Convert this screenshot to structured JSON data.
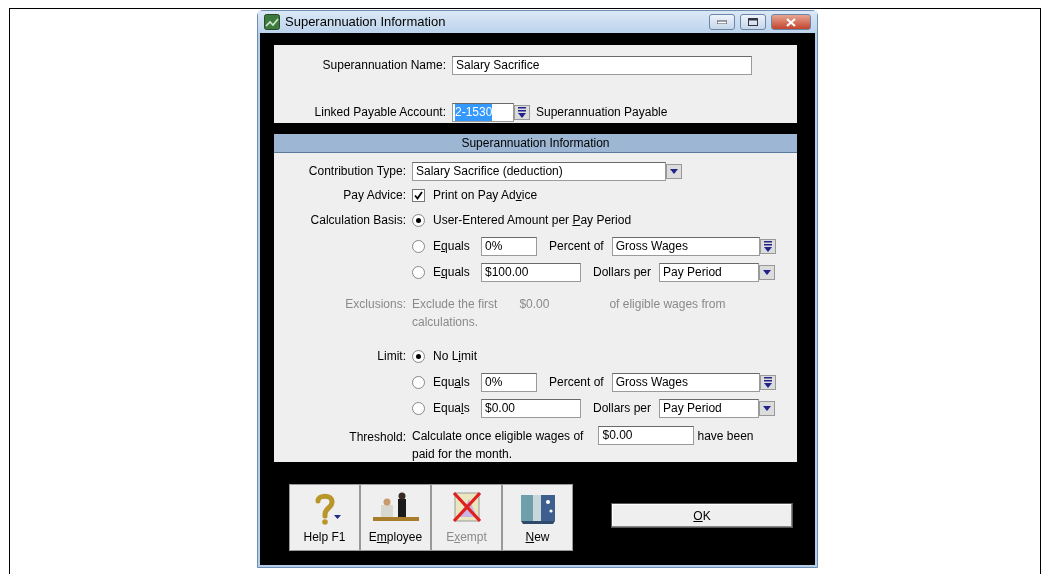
{
  "window": {
    "title": "Superannuation Information"
  },
  "name_field": {
    "label": "Superannuation Name:",
    "value": "Salary Sacrifice"
  },
  "linked_account": {
    "label": "Linked Payable Account:",
    "value": "2-1530",
    "selected": true,
    "account_name": "Superannuation Payable"
  },
  "section_header": "Superannuation Information",
  "contribution_type": {
    "label": "Contribution Type:",
    "value": "Salary Sacrifice (deduction)"
  },
  "pay_advice": {
    "label": "Pay Advice:",
    "checked": true,
    "option_parts": [
      {
        "text": "Print on Pay Ad",
        "underlined": false
      },
      {
        "text": "v",
        "underlined": true
      },
      {
        "text": "ice",
        "underlined": false
      }
    ]
  },
  "calculation_basis": {
    "label": "Calculation Basis:",
    "options": [
      {
        "kind": "plain",
        "selected": true,
        "label_parts": [
          {
            "text": "User-Entered Amount per ",
            "underlined": false
          },
          {
            "text": "P",
            "underlined": true
          },
          {
            "text": "ay Period",
            "underlined": false
          }
        ]
      },
      {
        "kind": "percent",
        "selected": false,
        "label_parts": [
          {
            "text": "E",
            "underlined": false
          },
          {
            "text": "q",
            "underlined": true
          },
          {
            "text": "uals",
            "underlined": false
          }
        ],
        "value": "0%",
        "unit": "Percent of",
        "of": "Gross Wages",
        "list_button": true
      },
      {
        "kind": "dollars",
        "selected": false,
        "label_parts": [
          {
            "text": "E",
            "underlined": false
          },
          {
            "text": "q",
            "underlined": true
          },
          {
            "text": "uals",
            "underlined": false
          }
        ],
        "value": "$100.00",
        "unit": "Dollars per",
        "of": "Pay Period",
        "list_button": false
      }
    ]
  },
  "exclusions": {
    "label": "Exclusions:",
    "disabled": true,
    "text_before": "Exclude the first",
    "value": "$0.00",
    "text_after": "of eligible wages from",
    "text_wrap": "calculations."
  },
  "limit": {
    "label": "Limit:",
    "options": [
      {
        "kind": "plain",
        "selected": true,
        "label_parts": [
          {
            "text": "No L",
            "underlined": false
          },
          {
            "text": "i",
            "underlined": true
          },
          {
            "text": "mit",
            "underlined": false
          }
        ]
      },
      {
        "kind": "percent",
        "selected": false,
        "label_parts": [
          {
            "text": "Equ",
            "underlined": false
          },
          {
            "text": "a",
            "underlined": true
          },
          {
            "text": "ls",
            "underlined": false
          }
        ],
        "value": "0%",
        "unit": "Percent of",
        "of": "Gross Wages",
        "list_button": true
      },
      {
        "kind": "dollars",
        "selected": false,
        "label_parts": [
          {
            "text": "Equa",
            "underlined": false
          },
          {
            "text": "l",
            "underlined": true
          },
          {
            "text": "s",
            "underlined": false
          }
        ],
        "value": "$0.00",
        "unit": "Dollars per",
        "of": "Pay Period",
        "list_button": false
      }
    ]
  },
  "threshold": {
    "label": "Threshold:",
    "text_before": "Calculate once eligible wages of",
    "value": "$0.00",
    "text_after": "have been",
    "text_wrap": "paid for the month."
  },
  "toolbar": [
    {
      "kind": "help",
      "disabled": false,
      "label_parts": [
        {
          "text": "Help F1",
          "underlined": false
        }
      ]
    },
    {
      "kind": "employee",
      "disabled": false,
      "label_parts": [
        {
          "text": "E",
          "underlined": false
        },
        {
          "text": "m",
          "underlined": true
        },
        {
          "text": "ployee",
          "underlined": false
        }
      ]
    },
    {
      "kind": "exempt",
      "disabled": true,
      "label_parts": [
        {
          "text": "E",
          "underlined": false
        },
        {
          "text": "x",
          "underlined": true
        },
        {
          "text": "empt",
          "underlined": false
        }
      ]
    },
    {
      "kind": "new",
      "disabled": false,
      "label_parts": [
        {
          "text": "N",
          "underlined": true
        },
        {
          "text": "ew",
          "underlined": false
        }
      ]
    }
  ],
  "ok_button": {
    "label_parts": [
      {
        "text": "O",
        "underlined": true
      },
      {
        "text": "K",
        "underlined": false
      }
    ]
  }
}
